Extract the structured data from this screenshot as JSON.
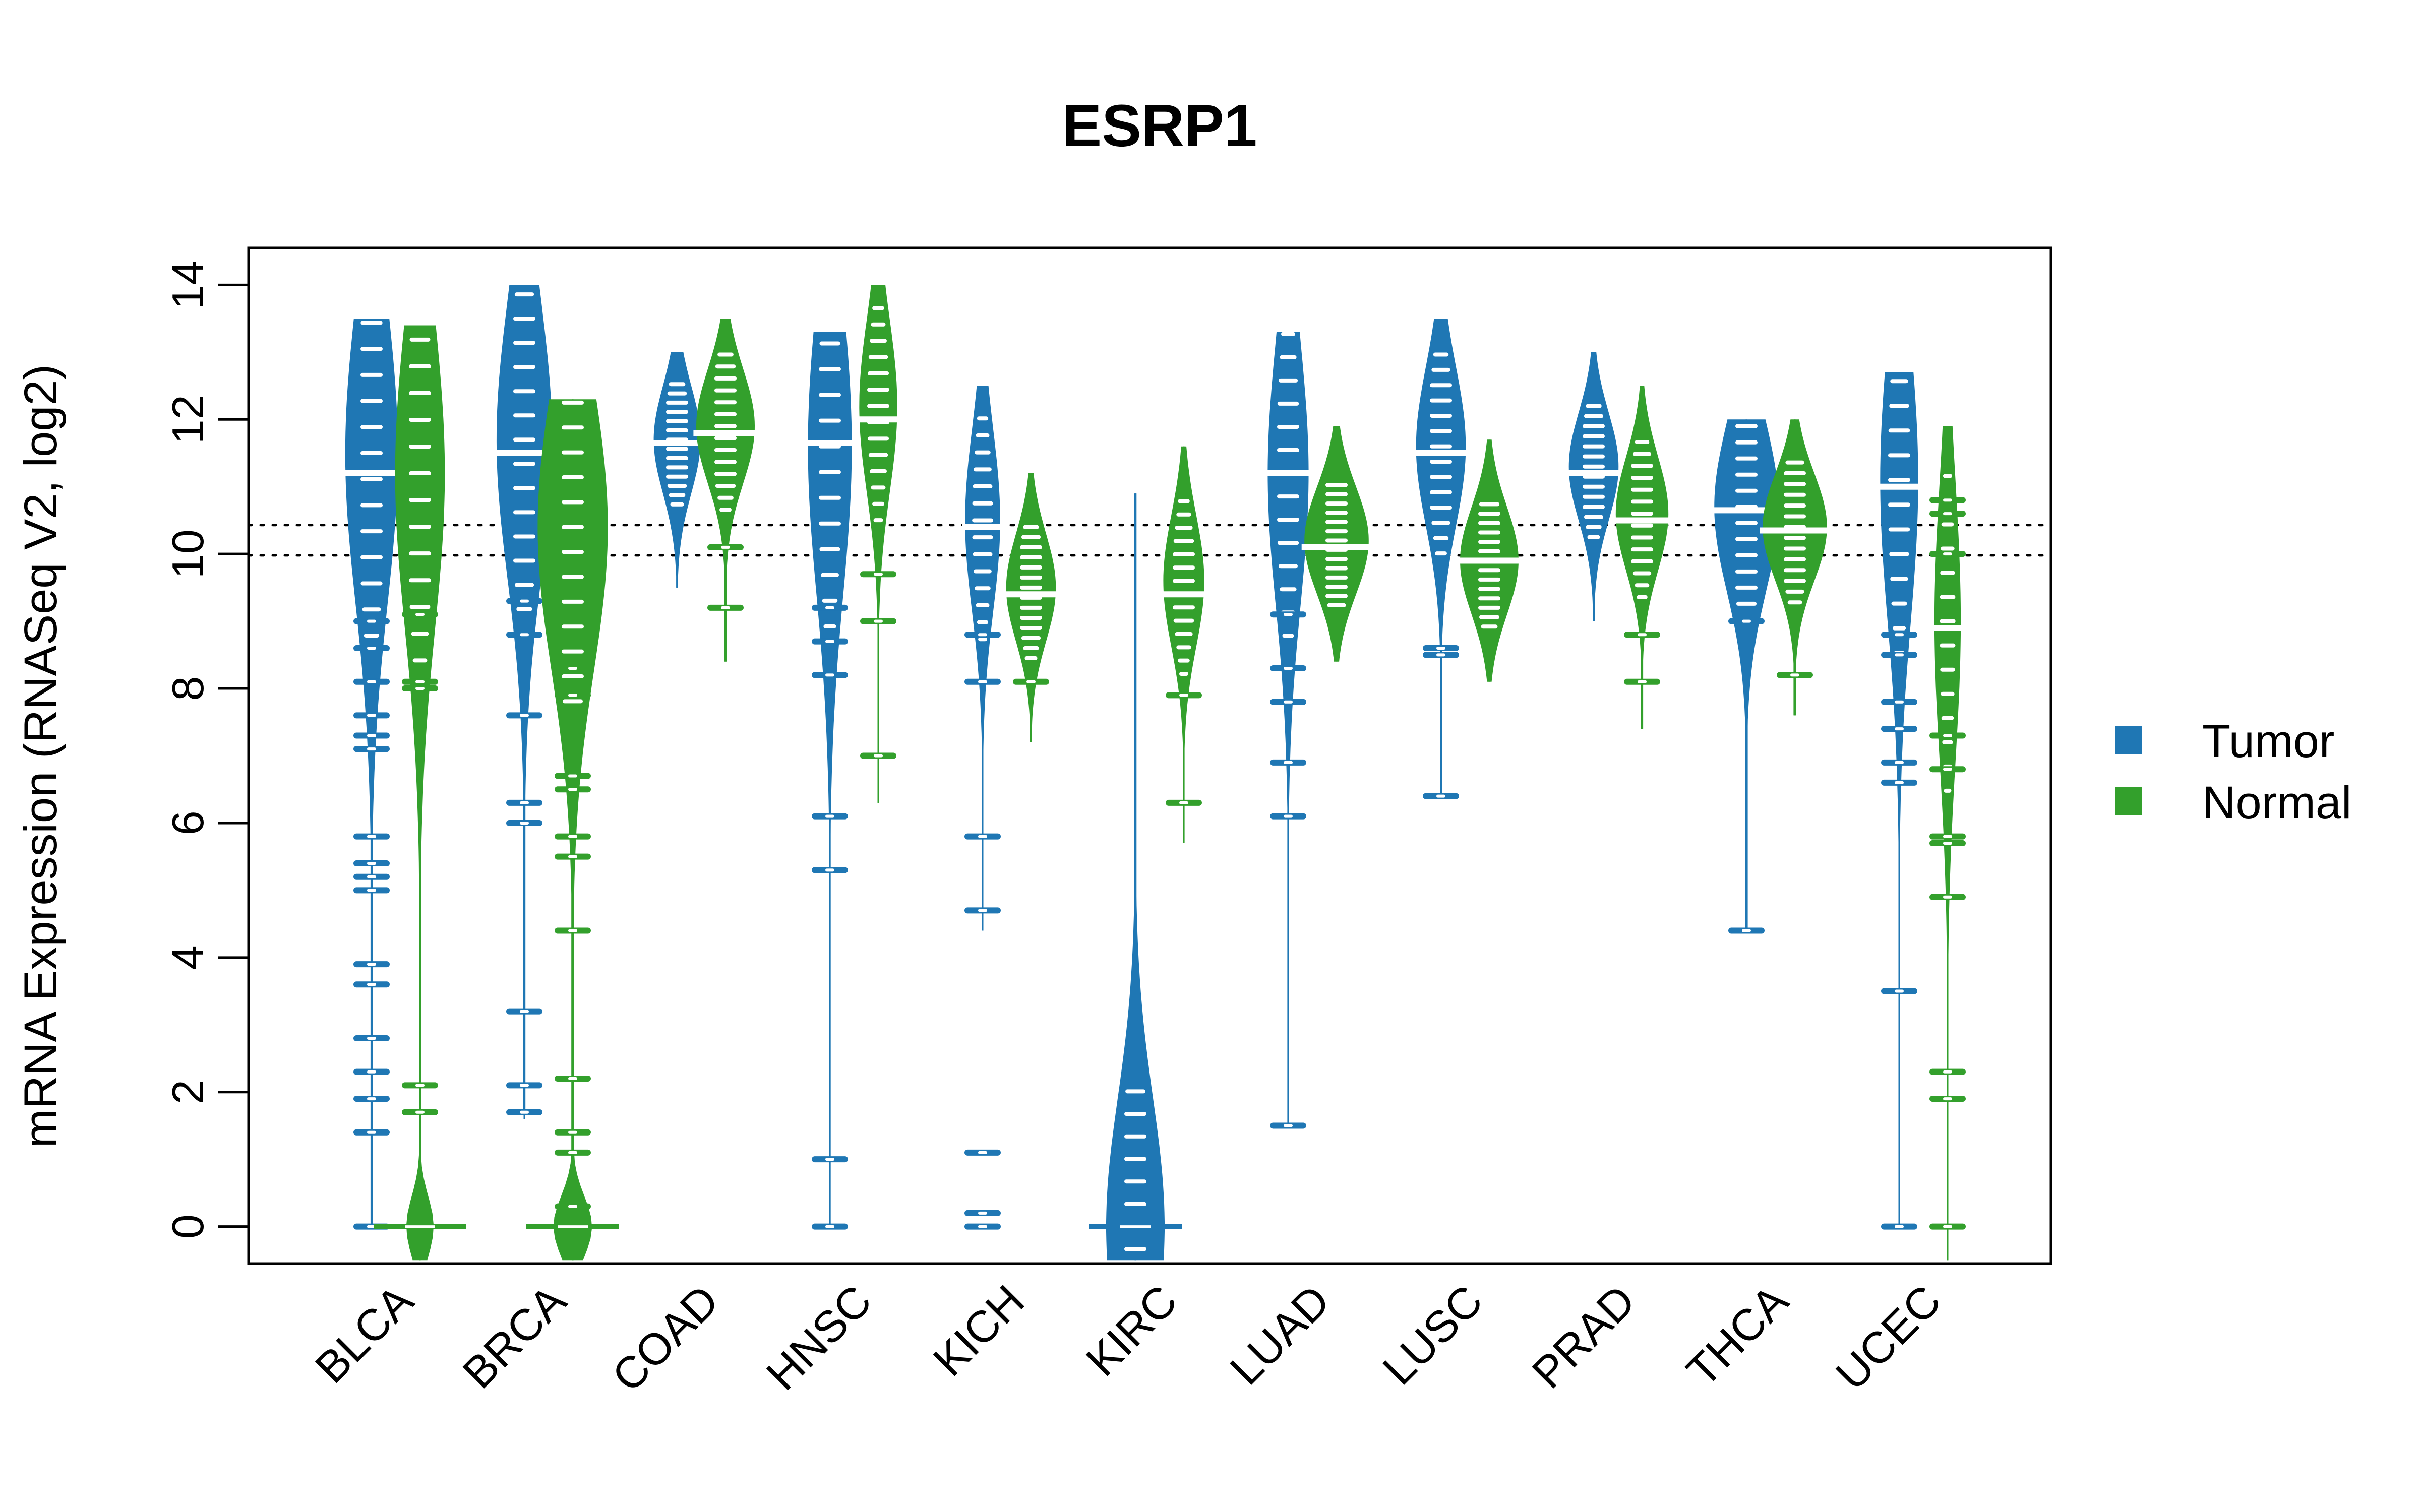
{
  "chart_data": {
    "type": "violin",
    "subtype": "beanplot",
    "title": "ESRP1",
    "xlabel": "",
    "ylabel": "mRNA Expression (RNASeq V2, log2)",
    "ylim": [
      -0.55,
      14.55
    ],
    "yticks": [
      0,
      2,
      4,
      6,
      8,
      10,
      12,
      14
    ],
    "grid": false,
    "legend_position": "right",
    "reference_lines": [
      10.43,
      9.98
    ],
    "categories": [
      "BLCA",
      "BRCA",
      "COAD",
      "HNSC",
      "KICH",
      "KIRC",
      "LUAD",
      "LUSC",
      "PRAD",
      "THCA",
      "UCEC"
    ],
    "series": [
      {
        "name": "Tumor",
        "color": "#1F77B4",
        "groups": [
          {
            "median": 11.2,
            "min": 0.0,
            "max": 13.5,
            "mode": 11.5,
            "width": 0.9,
            "outliers": [
              9.0,
              8.6,
              8.1,
              7.6,
              7.3,
              7.1,
              5.8,
              5.4,
              5.2,
              5.0,
              3.9,
              3.6,
              2.8,
              2.3,
              1.9,
              1.4,
              0.0
            ]
          },
          {
            "median": 11.5,
            "min": 1.6,
            "max": 14.0,
            "mode": 11.7,
            "width": 0.95,
            "outliers": [
              9.3,
              8.8,
              7.6,
              6.3,
              6.0,
              3.2,
              2.1,
              1.7
            ]
          },
          {
            "median": 11.65,
            "min": 9.5,
            "max": 13.0,
            "mode": 11.7,
            "width": 0.8,
            "outliers": []
          },
          {
            "median": 11.65,
            "min": 0.0,
            "max": 13.3,
            "mode": 11.6,
            "width": 0.75,
            "outliers": [
              9.2,
              8.7,
              8.2,
              6.1,
              5.3,
              1.0,
              0.0
            ]
          },
          {
            "median": 10.4,
            "min": 4.4,
            "max": 12.5,
            "mode": 10.5,
            "width": 0.6,
            "outliers": [
              8.8,
              8.1,
              5.8,
              4.7,
              1.1,
              0.2,
              0.0
            ]
          },
          {
            "median": 0.0,
            "min": -0.5,
            "max": 10.9,
            "mode": 0.0,
            "width": 1.0,
            "outliers": []
          },
          {
            "median": 11.2,
            "min": 1.5,
            "max": 13.3,
            "mode": 11.2,
            "width": 0.7,
            "outliers": [
              9.1,
              8.3,
              7.8,
              6.9,
              6.1,
              1.5
            ]
          },
          {
            "median": 11.5,
            "min": 6.4,
            "max": 13.5,
            "mode": 11.6,
            "width": 0.85,
            "outliers": [
              8.6,
              8.5,
              6.4
            ]
          },
          {
            "median": 11.2,
            "min": 9.0,
            "max": 13.0,
            "mode": 11.3,
            "width": 0.85,
            "outliers": []
          },
          {
            "median": 10.65,
            "min": 4.4,
            "max": 12.0,
            "mode": 10.7,
            "width": 1.1,
            "outliers": [
              9.0,
              4.4
            ]
          },
          {
            "median": 11.0,
            "min": 0.0,
            "max": 12.7,
            "mode": 11.1,
            "width": 0.65,
            "outliers": [
              8.8,
              8.5,
              7.8,
              7.4,
              6.9,
              6.6,
              3.5,
              0.0
            ]
          }
        ]
      },
      {
        "name": "Normal",
        "color": "#33A02C",
        "groups": [
          {
            "median": 0.0,
            "min": -0.5,
            "max": 13.4,
            "mode": 11.2,
            "width": 0.85,
            "second_mode": 0.0,
            "outliers": [
              9.1,
              8.1,
              8.0,
              2.1,
              1.7
            ]
          },
          {
            "median": 0.0,
            "min": -0.5,
            "max": 12.3,
            "mode": 10.4,
            "width": 1.2,
            "second_mode": 0.0,
            "outliers": [
              8.3,
              7.9,
              6.7,
              6.5,
              5.8,
              5.5,
              4.4,
              2.2,
              1.4,
              1.1,
              0.3
            ]
          },
          {
            "median": 11.8,
            "min": 8.4,
            "max": 13.5,
            "mode": 11.9,
            "width": 1.0,
            "outliers": [
              10.1,
              9.2
            ]
          },
          {
            "median": 12.0,
            "min": 6.3,
            "max": 14.0,
            "mode": 12.2,
            "width": 0.65,
            "outliers": [
              9.7,
              9.0,
              7.0
            ]
          },
          {
            "median": 9.4,
            "min": 7.2,
            "max": 11.2,
            "mode": 9.5,
            "width": 0.85,
            "outliers": [
              8.1
            ]
          },
          {
            "median": 9.4,
            "min": 5.7,
            "max": 11.6,
            "mode": 9.6,
            "width": 0.7,
            "outliers": [
              7.9,
              6.3
            ]
          },
          {
            "median": 10.1,
            "min": 8.4,
            "max": 11.9,
            "mode": 10.2,
            "width": 1.1,
            "outliers": []
          },
          {
            "median": 9.9,
            "min": 8.1,
            "max": 11.7,
            "mode": 9.9,
            "width": 1.0,
            "outliers": []
          },
          {
            "median": 10.5,
            "min": 7.4,
            "max": 12.5,
            "mode": 10.6,
            "width": 0.9,
            "outliers": [
              8.8,
              8.1
            ]
          },
          {
            "median": 10.35,
            "min": 7.6,
            "max": 12.0,
            "mode": 10.4,
            "width": 1.1,
            "outliers": [
              8.2
            ]
          },
          {
            "median": 8.9,
            "min": -0.5,
            "max": 11.9,
            "mode": 9.0,
            "width": 0.45,
            "outliers": [
              10.8,
              10.6,
              10.0,
              7.3,
              6.8,
              5.8,
              5.7,
              4.9,
              2.3,
              1.9,
              0.0
            ]
          }
        ]
      }
    ],
    "legend": [
      {
        "label": "Tumor",
        "color": "#1F77B4"
      },
      {
        "label": "Normal",
        "color": "#33A02C"
      }
    ]
  }
}
